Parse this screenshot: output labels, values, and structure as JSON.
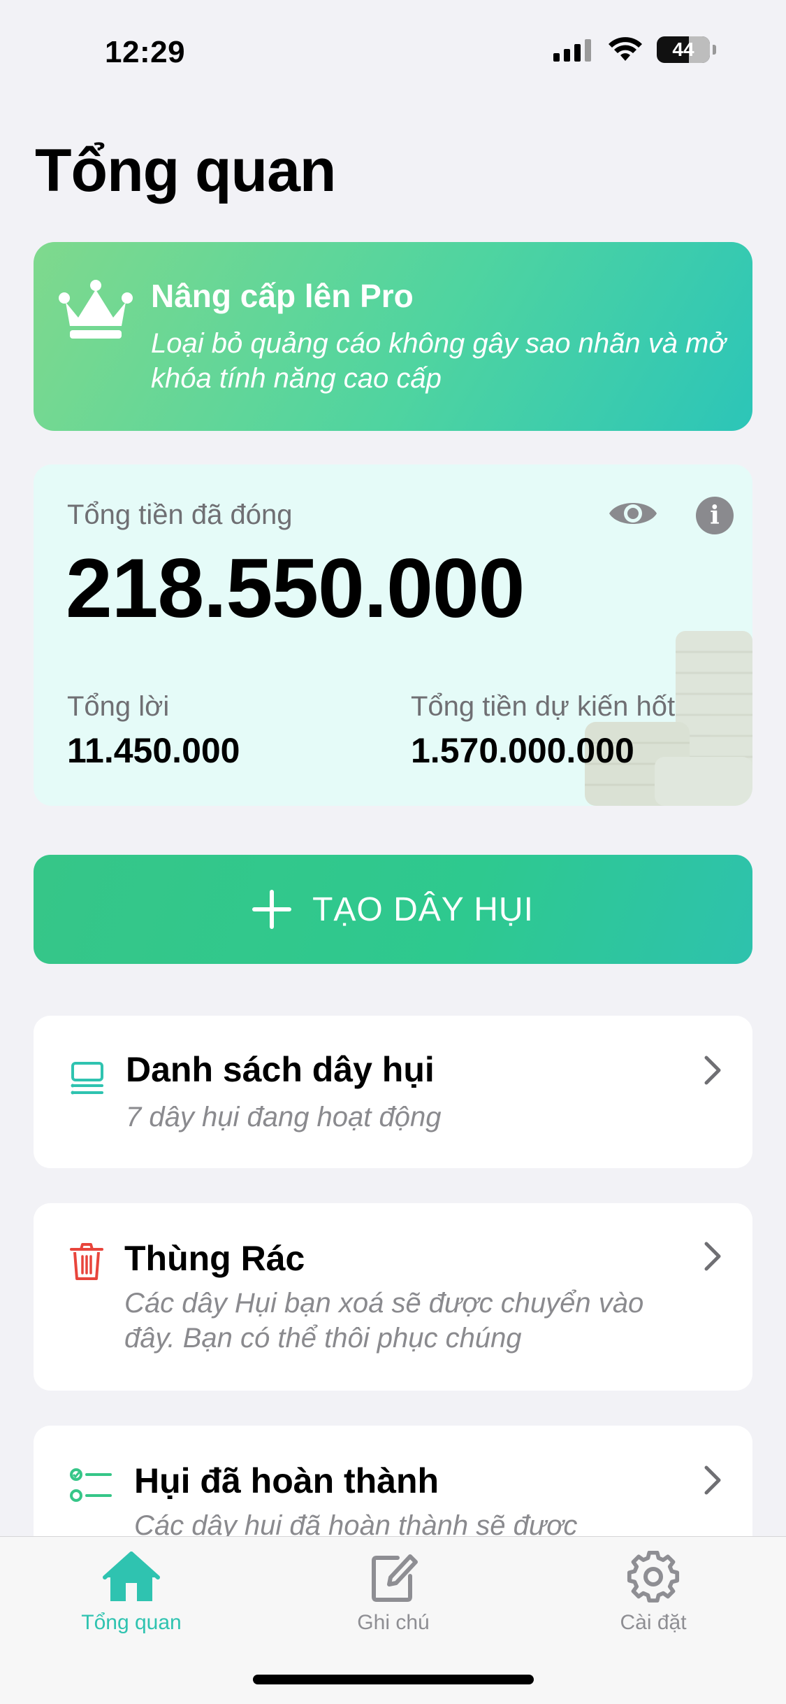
{
  "status_bar": {
    "time": "12:29",
    "battery": "44"
  },
  "page": {
    "title": "Tổng quan"
  },
  "pro_banner": {
    "icon": "crown-icon",
    "title": "Nâng cấp lên Pro",
    "subtitle": "Loại bỏ quảng cáo không gây sao nhãn và mở khóa tính năng cao cấp"
  },
  "summary": {
    "total_paid_label": "Tổng tiền đã đóng",
    "total_paid_value": "218.550.000",
    "profit_label": "Tổng lời",
    "profit_value": "11.450.000",
    "expected_label": "Tổng tiền dự kiến hốt",
    "expected_value": "1.570.000.000"
  },
  "create_button": {
    "label": "TẠO DÂY HỤI"
  },
  "cards": [
    {
      "title": "Danh sách dây hụi",
      "subtitle": "7 dây hụi đang hoạt động",
      "icon": "list-icon"
    },
    {
      "title": "Thùng Rác",
      "subtitle": "Các dây Hụi bạn xoá sẽ được chuyển vào đây. Bạn có thể thôi phục chúng",
      "icon": "trash-icon"
    },
    {
      "title": "Hụi đã hoàn thành",
      "subtitle": "Các dây hụi đã hoàn thành sẽ được",
      "icon": "checklist-icon"
    }
  ],
  "tabs": [
    {
      "label": "Tổng quan",
      "icon": "home-icon",
      "active": true
    },
    {
      "label": "Ghi chú",
      "icon": "note-edit-icon",
      "active": false
    },
    {
      "label": "Cài đặt",
      "icon": "gear-icon",
      "active": false
    }
  ],
  "colors": {
    "accent": "#2fc3b0",
    "green": "#36c688",
    "danger": "#e8453c",
    "card_tint": "#e5fbf8"
  }
}
